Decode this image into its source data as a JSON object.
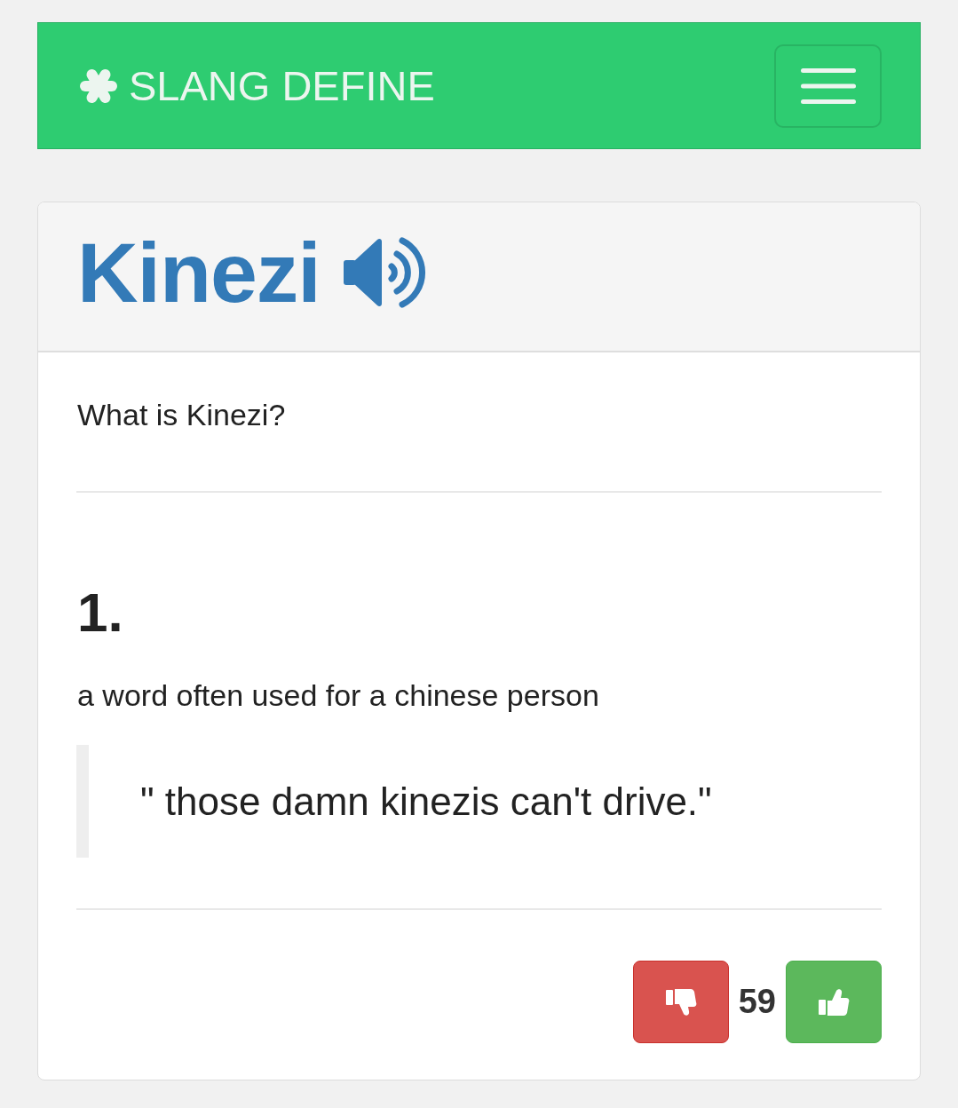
{
  "navbar": {
    "brand": "SLANG DEFINE"
  },
  "word": {
    "title": "Kinezi"
  },
  "question": "What is Kinezi?",
  "definitions": [
    {
      "number": "1.",
      "meaning": "a word often used for a chinese person",
      "example": "\" those damn kinezis can't drive.\"",
      "score": "59"
    }
  ]
}
